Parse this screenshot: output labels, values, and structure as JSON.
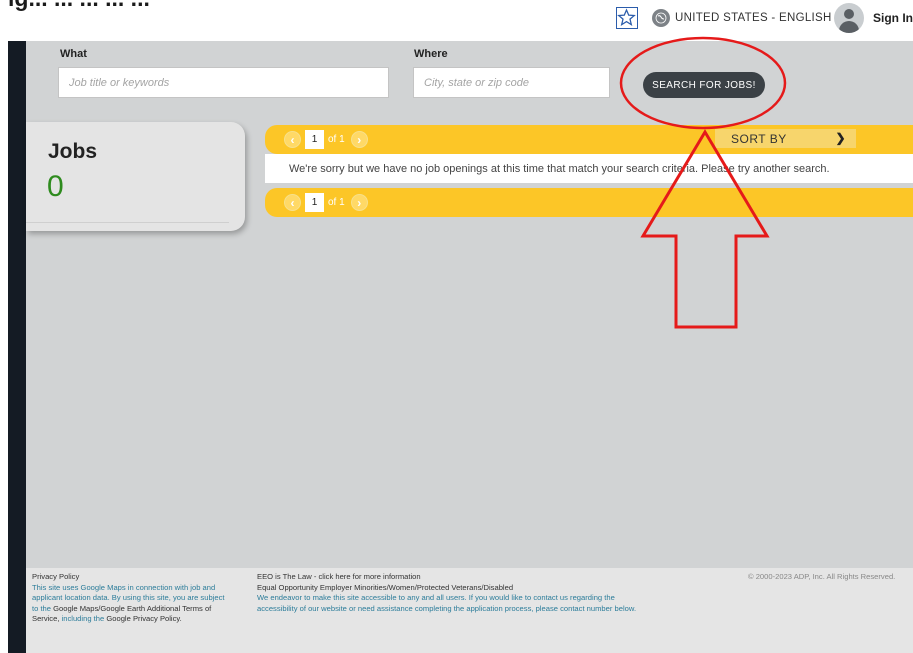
{
  "page": {
    "partial_heading": "ig... ... ... ... ..."
  },
  "header": {
    "locale_label": "UNITED STATES - ENGLISH",
    "sign_in_label": "Sign In"
  },
  "search": {
    "what_label": "What",
    "what_placeholder": "Job title or keywords",
    "where_label": "Where",
    "where_placeholder": "City, state or zip code",
    "button_label": "SEARCH FOR JOBS!"
  },
  "jobs_summary": {
    "title": "Jobs",
    "count": "0"
  },
  "pagination": {
    "current_page": "1",
    "of_label": "of 1"
  },
  "sort": {
    "label": "SORT BY"
  },
  "results": {
    "message": "We're sorry but we have no job openings at this time that match your search criteria. Please try another search."
  },
  "footer": {
    "privacy_title": "Privacy Policy",
    "maps_line_1": "This site uses Google Maps in connection with job and",
    "maps_line_2": "applicant location data. By using this site, you are subject",
    "maps_line_3_link": "to the",
    "maps_line_3_text": "Google Maps/Google Earth Additional Terms of",
    "maps_line_4_text": "Service,",
    "maps_line_4_link": "including the",
    "maps_line_4_end": "Google Privacy Policy.",
    "eeo_law": "EEO is The Law - click here for more information",
    "eeo_statement": "Equal Opportunity Employer Minorities/Women/Protected Veterans/Disabled",
    "access_line_1": "We endeavor to make this site accessible to any and all users. If you would like to contact us regarding the",
    "access_line_2": "accessibility of our website or need assistance completing the application process, please contact number below.",
    "copyright": "© 2000-2023 ADP, Inc. All Rights Reserved."
  },
  "colors": {
    "pager_yellow": "#fcc627",
    "search_button": "#3b4146",
    "jobs_count_green": "#2e8b1e",
    "sidebar_dark": "#141b24",
    "annotation_red": "#e51a1a"
  },
  "icons": [
    "star-icon",
    "globe-icon",
    "chevron-down-icon",
    "user-avatar-icon",
    "chevron-left-icon",
    "chevron-right-icon"
  ]
}
